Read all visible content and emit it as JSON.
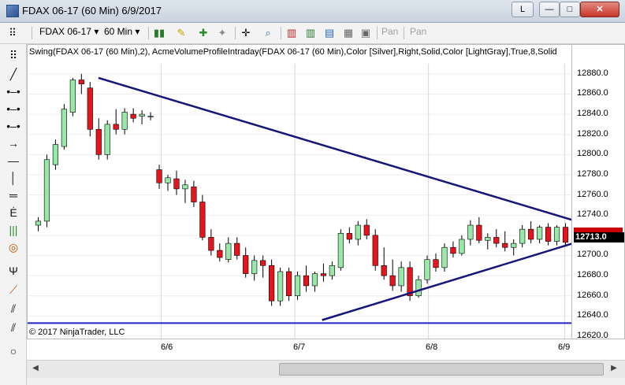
{
  "window": {
    "title": "FDAX 06-17 (60 Min)  6/9/2017",
    "btn_l": "L",
    "btn_min": "—",
    "btn_max": "□",
    "btn_close": "✕"
  },
  "toolbar": {
    "instrument": "FDAX 06-17",
    "interval": "60 Min",
    "pan1": "Pan",
    "pan2": "Pan"
  },
  "chart": {
    "indicator_label": "Swing(FDAX 06-17 (60 Min),2), AcmeVolumeProfileIntraday(FDAX 06-17 (60 Min),Color [Silver],Right,Solid,Color [LightGray],True,8,Solid",
    "copyright": "© 2017 NinjaTrader, LLC",
    "last_price": "12713.0",
    "y_ticks": [
      "12880.0",
      "12860.0",
      "12840.0",
      "12820.0",
      "12800.0",
      "12780.0",
      "12760.0",
      "12740.0",
      "12720.0",
      "12700.0",
      "12680.0",
      "12660.0",
      "12640.0",
      "12620.0"
    ],
    "x_ticks": [
      "6/6",
      "6/7",
      "6/8",
      "6/9"
    ],
    "colors": {
      "up": "#98e8a8",
      "down": "#e8141c",
      "trendline": "#16167a",
      "swing": "#1a7a1a",
      "support": "#2222cc"
    }
  },
  "chart_data": {
    "type": "candlestick",
    "ylim": [
      12620,
      12890
    ],
    "candles": [
      {
        "o": 12730,
        "h": 12738,
        "l": 12724,
        "c": 12734
      },
      {
        "o": 12734,
        "h": 12800,
        "l": 12728,
        "c": 12795
      },
      {
        "o": 12790,
        "h": 12815,
        "l": 12785,
        "c": 12810
      },
      {
        "o": 12808,
        "h": 12850,
        "l": 12805,
        "c": 12845
      },
      {
        "o": 12842,
        "h": 12876,
        "l": 12838,
        "c": 12874
      },
      {
        "o": 12874,
        "h": 12880,
        "l": 12860,
        "c": 12870
      },
      {
        "o": 12866,
        "h": 12872,
        "l": 12818,
        "c": 12825
      },
      {
        "o": 12825,
        "h": 12836,
        "l": 12795,
        "c": 12800
      },
      {
        "o": 12800,
        "h": 12834,
        "l": 12795,
        "c": 12830
      },
      {
        "o": 12830,
        "h": 12845,
        "l": 12820,
        "c": 12825
      },
      {
        "o": 12825,
        "h": 12846,
        "l": 12820,
        "c": 12842
      },
      {
        "o": 12840,
        "h": 12846,
        "l": 12832,
        "c": 12836
      },
      {
        "o": 12838,
        "h": 12844,
        "l": 12830,
        "c": 12840
      },
      {
        "o": 12838,
        "h": 12842,
        "l": 12834,
        "c": 12838
      },
      {
        "o": 12785,
        "h": 12790,
        "l": 12766,
        "c": 12772
      },
      {
        "o": 12772,
        "h": 12780,
        "l": 12764,
        "c": 12777
      },
      {
        "o": 12776,
        "h": 12784,
        "l": 12760,
        "c": 12766
      },
      {
        "o": 12766,
        "h": 12775,
        "l": 12752,
        "c": 12770
      },
      {
        "o": 12768,
        "h": 12774,
        "l": 12748,
        "c": 12753
      },
      {
        "o": 12753,
        "h": 12760,
        "l": 12715,
        "c": 12718
      },
      {
        "o": 12718,
        "h": 12726,
        "l": 12700,
        "c": 12705
      },
      {
        "o": 12705,
        "h": 12712,
        "l": 12694,
        "c": 12698
      },
      {
        "o": 12696,
        "h": 12718,
        "l": 12693,
        "c": 12712
      },
      {
        "o": 12712,
        "h": 12718,
        "l": 12696,
        "c": 12700
      },
      {
        "o": 12700,
        "h": 12708,
        "l": 12678,
        "c": 12682
      },
      {
        "o": 12682,
        "h": 12700,
        "l": 12675,
        "c": 12695
      },
      {
        "o": 12695,
        "h": 12700,
        "l": 12678,
        "c": 12690
      },
      {
        "o": 12690,
        "h": 12696,
        "l": 12650,
        "c": 12655
      },
      {
        "o": 12655,
        "h": 12688,
        "l": 12650,
        "c": 12684
      },
      {
        "o": 12684,
        "h": 12688,
        "l": 12655,
        "c": 12660
      },
      {
        "o": 12660,
        "h": 12684,
        "l": 12656,
        "c": 12680
      },
      {
        "o": 12680,
        "h": 12690,
        "l": 12664,
        "c": 12670
      },
      {
        "o": 12670,
        "h": 12684,
        "l": 12664,
        "c": 12682
      },
      {
        "o": 12682,
        "h": 12692,
        "l": 12674,
        "c": 12680
      },
      {
        "o": 12680,
        "h": 12694,
        "l": 12676,
        "c": 12690
      },
      {
        "o": 12688,
        "h": 12726,
        "l": 12685,
        "c": 12722
      },
      {
        "o": 12722,
        "h": 12728,
        "l": 12712,
        "c": 12716
      },
      {
        "o": 12716,
        "h": 12734,
        "l": 12710,
        "c": 12730
      },
      {
        "o": 12730,
        "h": 12736,
        "l": 12716,
        "c": 12720
      },
      {
        "o": 12720,
        "h": 12726,
        "l": 12685,
        "c": 12690
      },
      {
        "o": 12690,
        "h": 12708,
        "l": 12676,
        "c": 12680
      },
      {
        "o": 12680,
        "h": 12696,
        "l": 12665,
        "c": 12670
      },
      {
        "o": 12670,
        "h": 12694,
        "l": 12664,
        "c": 12688
      },
      {
        "o": 12688,
        "h": 12694,
        "l": 12655,
        "c": 12660
      },
      {
        "o": 12660,
        "h": 12680,
        "l": 12658,
        "c": 12676
      },
      {
        "o": 12676,
        "h": 12700,
        "l": 12672,
        "c": 12696
      },
      {
        "o": 12696,
        "h": 12702,
        "l": 12684,
        "c": 12688
      },
      {
        "o": 12688,
        "h": 12712,
        "l": 12684,
        "c": 12708
      },
      {
        "o": 12708,
        "h": 12714,
        "l": 12698,
        "c": 12702
      },
      {
        "o": 12702,
        "h": 12720,
        "l": 12700,
        "c": 12716
      },
      {
        "o": 12716,
        "h": 12735,
        "l": 12710,
        "c": 12730
      },
      {
        "o": 12730,
        "h": 12738,
        "l": 12712,
        "c": 12715
      },
      {
        "o": 12715,
        "h": 12722,
        "l": 12706,
        "c": 12718
      },
      {
        "o": 12718,
        "h": 12726,
        "l": 12708,
        "c": 12712
      },
      {
        "o": 12712,
        "h": 12724,
        "l": 12704,
        "c": 12708
      },
      {
        "o": 12708,
        "h": 12716,
        "l": 12700,
        "c": 12712
      },
      {
        "o": 12712,
        "h": 12730,
        "l": 12708,
        "c": 12726
      },
      {
        "o": 12726,
        "h": 12734,
        "l": 12712,
        "c": 12716
      },
      {
        "o": 12716,
        "h": 12730,
        "l": 12712,
        "c": 12728
      },
      {
        "o": 12728,
        "h": 12732,
        "l": 12710,
        "c": 12714
      },
      {
        "o": 12714,
        "h": 12730,
        "l": 12710,
        "c": 12728
      },
      {
        "o": 12728,
        "h": 12732,
        "l": 12710,
        "c": 12713
      }
    ],
    "trendlines": [
      {
        "x1": 0.13,
        "y1": 12876,
        "x2": 1.0,
        "y2": 12735
      },
      {
        "x1": 0.54,
        "y1": 12636,
        "x2": 1.0,
        "y2": 12712
      }
    ],
    "support_line": 12633
  }
}
